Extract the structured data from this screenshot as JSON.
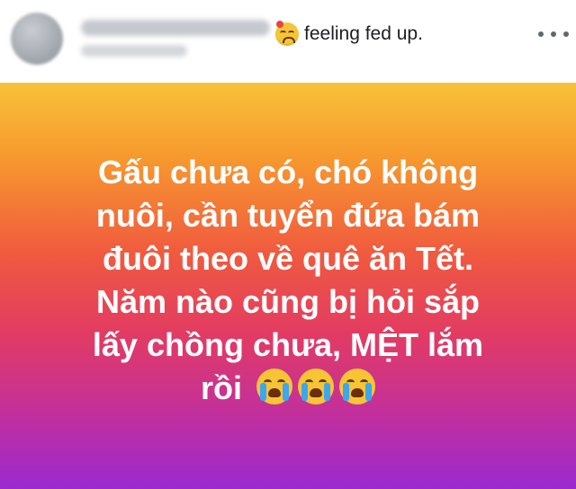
{
  "header": {
    "feeling_label": "feeling fed up.",
    "feeling_icon": "tired-face-icon"
  },
  "post": {
    "line1": "Gấu chưa có, chó không",
    "line2": "nuôi, cần tuyển đứa bám",
    "line3": "đuôi theo về quê ăn Tết.",
    "line4": "Năm nào cũng bị hỏi sắp",
    "line5": "lấy chồng chưa, MỆT lắm",
    "line6": "rồi",
    "emoji_icon": "loudly-crying-face-icon",
    "emoji_count": 3,
    "gradient_colors": [
      "#f8c23a",
      "#f79a2e",
      "#f05a3f",
      "#e23b63",
      "#c12f9e",
      "#9a2ad0"
    ]
  }
}
